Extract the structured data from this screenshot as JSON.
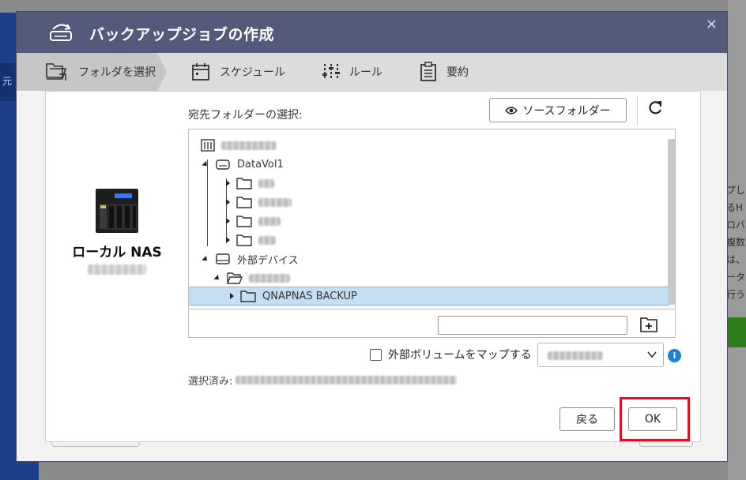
{
  "dialog": {
    "title": "バックアップジョブの作成",
    "close_label": "×"
  },
  "steps": [
    {
      "label": "フォルダを選択",
      "icon": "folder-select-icon",
      "active": true
    },
    {
      "label": "スケジュール",
      "icon": "calendar-icon",
      "active": false
    },
    {
      "label": "ルール",
      "icon": "sliders-icon",
      "active": false
    },
    {
      "label": "要約",
      "icon": "clipboard-icon",
      "active": false
    }
  ],
  "local_nas": {
    "name": "ローカル NAS"
  },
  "destination": {
    "label": "宛先フォルダーの選択:",
    "source_folder_button": "ソースフォルダー",
    "tree": {
      "volume": "DataVol1",
      "external": "外部デバイス",
      "selected_folder": "QNAPNAS BACKUP"
    },
    "new_folder_input": ""
  },
  "map_external": {
    "label": "外部ボリュームをマップする",
    "checked": false
  },
  "selected": {
    "label": "選択済み:"
  },
  "buttons": {
    "back": "戻る",
    "ok": "OK"
  },
  "background": {
    "left_tab": "元",
    "right_lines": [
      "プし",
      "るH",
      "ロバ",
      "複数",
      "は、",
      "ータ",
      "行う"
    ]
  },
  "colors": {
    "titlebar": "#535a7a",
    "selection": "#c6def4",
    "highlight_frame": "#e0101e",
    "info": "#1a7fd8"
  }
}
